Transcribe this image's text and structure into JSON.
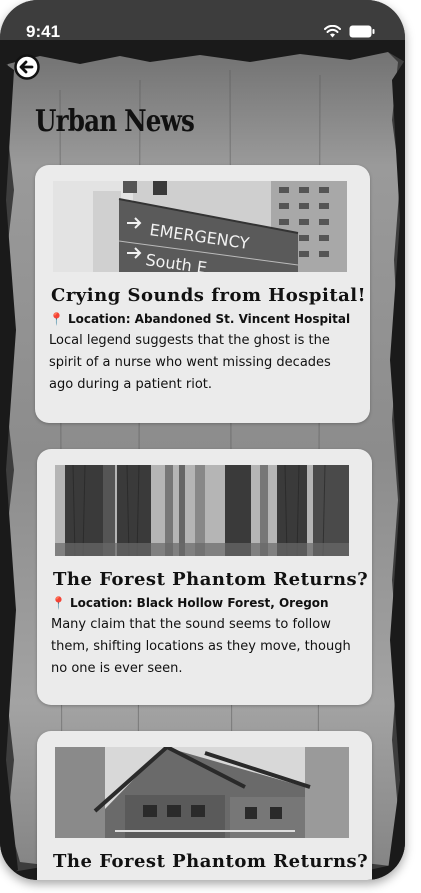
{
  "status_bar": {
    "time": "9:41"
  },
  "header": {
    "title": "Urban News"
  },
  "icons": {
    "back": "back-arrow-icon",
    "wifi": "wifi-icon",
    "battery": "battery-icon",
    "pin": "map-pin-icon"
  },
  "colors": {
    "pin": "#d23a2a",
    "card_bg": "#ebebeb",
    "frame": "#1a1a1a"
  },
  "cards": [
    {
      "title": "Crying Sounds from Hospital!",
      "location": "Location: Abandoned St. Vincent Hospital",
      "description": "Local legend suggests that the ghost is the spirit of a nurse who went missing decades ago during a patient riot.",
      "sign_lines": [
        "EMERGENCY",
        "South E"
      ]
    },
    {
      "title": "The Forest Phantom Returns?",
      "location": "Location: Black Hollow Forest, Oregon",
      "description": "Many claim that the sound seems to follow them, shifting locations as they move, though no one is ever seen."
    },
    {
      "title": "The Forest Phantom Returns?"
    }
  ]
}
